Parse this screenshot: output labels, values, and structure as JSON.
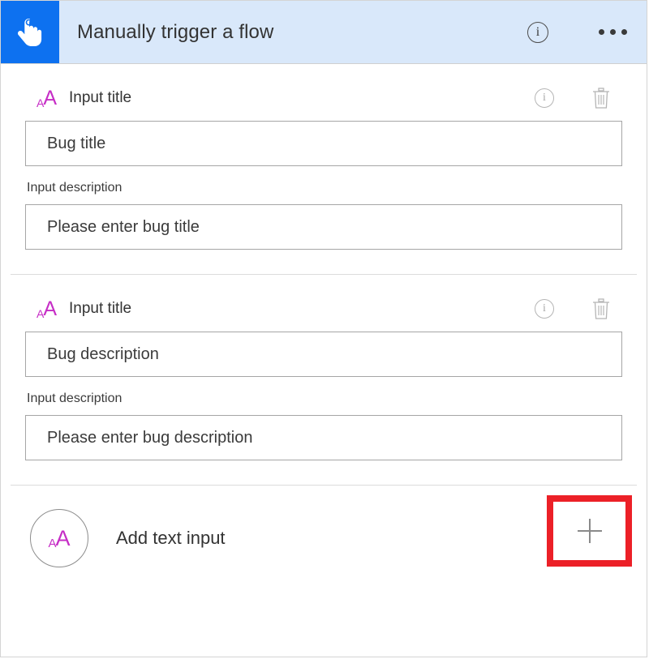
{
  "header": {
    "title": "Manually trigger a flow",
    "trigger_icon": "tap-hand-icon",
    "info_icon": "info-icon",
    "info_glyph": "i",
    "more_icon": "ellipsis-icon",
    "icon_background": "#0d71f0",
    "background": "#d9e8fa"
  },
  "sections": [
    {
      "icon": "text-input-icon",
      "icon_small": "A",
      "icon_large": "A",
      "title_label": "Input title",
      "title_value": "Bug title",
      "description_label": "Input description",
      "description_value": "Please enter bug title",
      "info_icon": "info-icon",
      "info_glyph": "i",
      "delete_icon": "trash-icon"
    },
    {
      "icon": "text-input-icon",
      "icon_small": "A",
      "icon_large": "A",
      "title_label": "Input title",
      "title_value": "Bug description",
      "description_label": "Input description",
      "description_value": "Please enter bug description",
      "info_icon": "info-icon",
      "info_glyph": "i",
      "delete_icon": "trash-icon"
    }
  ],
  "add_row": {
    "icon": "text-input-icon",
    "icon_small": "A",
    "icon_large": "A",
    "label": "Add text input",
    "plus_icon": "plus-icon",
    "highlight_color": "#ec2027"
  },
  "colors": {
    "accent_magenta": "#c62ec6",
    "header_blue": "#0d71f0",
    "header_bg": "#d9e8fa",
    "highlight_red": "#ec2027"
  }
}
